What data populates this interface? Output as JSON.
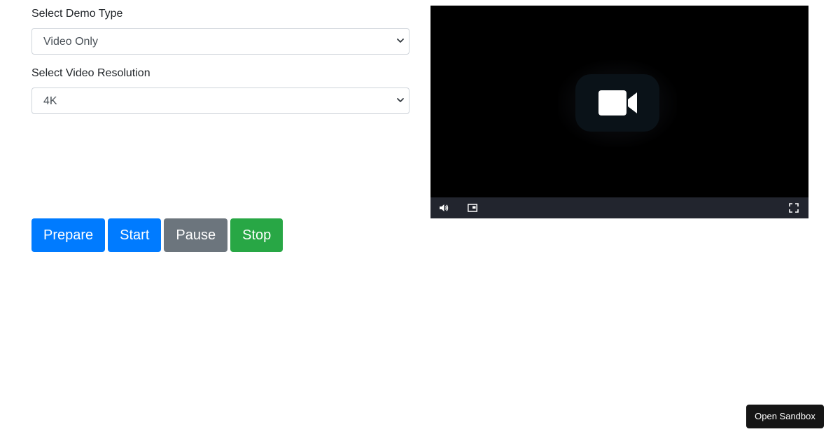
{
  "form": {
    "demo_type": {
      "label": "Select Demo Type",
      "selected": "Video Only"
    },
    "resolution": {
      "label": "Select Video Resolution",
      "selected": "4K"
    }
  },
  "actions": {
    "prepare": "Prepare",
    "start": "Start",
    "pause": "Pause",
    "stop": "Stop"
  },
  "video_player": {
    "placeholder_icon": "video-camera-icon",
    "controls": [
      "volume-icon",
      "picture-in-picture-icon",
      "fullscreen-icon"
    ]
  },
  "sandbox": {
    "label": "Open Sandbox"
  },
  "colors": {
    "primary": "#007bff",
    "secondary": "#6c757d",
    "success": "#28a745",
    "video_bg": "#000000",
    "controls_bg": "#22252e",
    "sandbox_bg": "#151515"
  }
}
